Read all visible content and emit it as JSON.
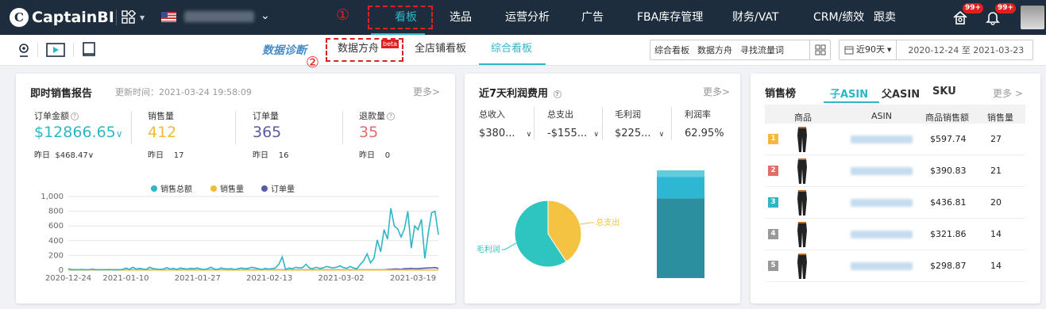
{
  "header": {
    "logo_text": "CaptainBI",
    "nav": [
      "看板",
      "选品",
      "运营分析",
      "广告",
      "FBA库存管理",
      "财务/VAT",
      "CRM/绩效",
      "跟卖"
    ],
    "active_nav": "看板",
    "badges": [
      "99+",
      "99+"
    ],
    "annotation_1": "①",
    "annotation_2": "②"
  },
  "subbar": {
    "brand": "数据诊断",
    "tabs": [
      "数据方舟",
      "全店铺看板",
      "综合看板"
    ],
    "active_tab": "综合看板",
    "beta": "beta",
    "quick_links": [
      "综合看板",
      "数据方舟",
      "寻找流量词"
    ],
    "date_preset": "近90天",
    "date_range": "2020-12-24 至 2021-03-23"
  },
  "sales_report": {
    "title": "即时销售报告",
    "updated": "更新时间：2021-03-24 19:58:09",
    "more": "更多>",
    "metrics": [
      {
        "label": "订单金额",
        "value": "$12866.65",
        "suffix": "∨",
        "prev_label": "昨日",
        "prev": "$468.47",
        "prev_suffix": "∨",
        "color": "#2fb6c6"
      },
      {
        "label": "销售量",
        "value": "412",
        "prev_label": "昨日",
        "prev": "17",
        "color": "#f5b93a"
      },
      {
        "label": "订单量",
        "value": "365",
        "prev_label": "昨日",
        "prev": "16",
        "color": "#5a5aa8"
      },
      {
        "label": "退款量",
        "value": "35",
        "prev_label": "昨日",
        "prev": "0",
        "color": "#e56b6b"
      }
    ],
    "legend": [
      "销售总额",
      "销售量",
      "订单量"
    ]
  },
  "chart_data": {
    "type": "line",
    "x_ticks": [
      "2020-12-24",
      "2021-01-10",
      "2021-01-27",
      "2021-02-13",
      "2021-03-02",
      "2021-03-19"
    ],
    "ylim": [
      0,
      1000
    ],
    "y_ticks": [
      "0",
      "200",
      "400",
      "600",
      "800",
      "1,000"
    ],
    "legend_position": "top",
    "series": [
      {
        "name": "销售总额",
        "color": "#2fb6c6",
        "values": [
          20,
          5,
          8,
          5,
          10,
          5,
          5,
          15,
          8,
          5,
          8,
          5,
          10,
          5,
          8,
          5,
          10,
          30,
          10,
          40,
          15,
          25,
          15,
          10,
          40,
          20,
          15,
          10,
          15,
          35,
          15,
          25,
          10,
          30,
          20,
          15,
          25,
          20,
          30,
          15,
          10,
          20,
          40,
          15,
          10,
          30,
          20,
          15,
          20,
          10,
          20,
          30,
          20,
          25,
          40,
          30,
          20,
          10,
          25,
          15,
          20,
          30,
          80,
          180,
          10,
          30,
          20,
          40,
          30,
          35,
          80,
          30,
          20,
          40,
          25,
          30,
          50,
          40,
          30,
          40,
          60,
          35,
          25,
          50,
          30,
          20,
          80,
          130,
          220,
          100,
          160,
          410,
          250,
          550,
          420,
          840,
          600,
          560,
          450,
          560,
          800,
          300,
          600,
          550,
          690,
          160,
          500,
          780,
          800,
          480
        ]
      },
      {
        "name": "销售量",
        "color": "#f5b93a",
        "values": [
          3,
          3,
          3,
          3,
          3,
          3,
          3,
          3,
          3,
          3,
          3,
          3,
          3,
          3,
          3,
          3,
          3,
          3,
          3,
          3,
          3,
          3,
          3,
          3,
          3,
          3,
          3,
          3,
          3,
          3,
          3,
          3,
          3,
          3,
          3,
          3,
          3,
          3,
          3,
          3,
          3,
          3,
          3,
          3,
          3,
          3,
          3,
          3,
          3,
          3,
          3,
          3,
          3,
          3,
          3,
          3,
          3,
          3,
          3,
          3,
          3,
          3,
          3,
          3,
          3,
          3,
          3,
          3,
          3,
          3,
          3,
          3,
          3,
          3,
          3,
          3,
          3,
          3,
          3,
          3,
          3,
          3,
          3,
          3,
          3,
          3,
          3,
          3,
          3,
          3,
          3,
          3,
          3,
          3,
          3,
          3,
          3,
          3,
          3,
          3,
          3,
          3,
          3,
          3,
          3,
          3,
          3,
          3,
          3,
          3
        ]
      },
      {
        "name": "订单量",
        "color": "#5a5aa8",
        "values": [
          10,
          8,
          6,
          5,
          5,
          5,
          5,
          5,
          5,
          5,
          5,
          5,
          5,
          5,
          5,
          5,
          5,
          5,
          5,
          5,
          5,
          5,
          5,
          5,
          5,
          5,
          5,
          5,
          5,
          5,
          5,
          5,
          5,
          5,
          5,
          5,
          5,
          5,
          5,
          5,
          5,
          5,
          5,
          5,
          5,
          5,
          5,
          5,
          5,
          5,
          5,
          5,
          5,
          5,
          5,
          5,
          5,
          5,
          5,
          5,
          5,
          5,
          5,
          5,
          5,
          5,
          5,
          5,
          5,
          5,
          5,
          5,
          5,
          5,
          5,
          5,
          5,
          5,
          5,
          5,
          5,
          5,
          5,
          5,
          5,
          5,
          5,
          5,
          5,
          5,
          5,
          5,
          5,
          5,
          10,
          12,
          15,
          15,
          12,
          20,
          20,
          25,
          22,
          20,
          25,
          28,
          30,
          32,
          35,
          25
        ]
      }
    ]
  },
  "profit": {
    "title": "近7天利润费用",
    "more": "更多>",
    "cols": [
      {
        "label": "总收入",
        "value": "$380...",
        "suffix": "∨"
      },
      {
        "label": "总支出",
        "value": "-$155...",
        "suffix": "∨"
      },
      {
        "label": "毛利润",
        "value": "$225...",
        "suffix": "∨"
      },
      {
        "label": "利润率",
        "value": "62.95%"
      }
    ],
    "pie": {
      "labels": [
        "毛利润",
        "总支出"
      ],
      "values": [
        59.2,
        40.8
      ],
      "colors": [
        "#2ec4c0",
        "#f5c342"
      ]
    },
    "bar_segments": [
      {
        "value": 6
      },
      {
        "value": 20
      },
      {
        "value": 74
      }
    ],
    "bar_colors": [
      "#5fcddc",
      "#2db7d3",
      "#2b8f9f"
    ]
  },
  "ranking": {
    "title": "销售榜",
    "tabs": [
      "子ASIN",
      "父ASIN",
      "SKU"
    ],
    "active_tab": "子ASIN",
    "more": "更多 >",
    "headers": [
      "商品",
      "ASIN",
      "商品销售额",
      "销售量"
    ],
    "rows": [
      {
        "rank": "1",
        "amount": "$597.74",
        "qty": "27",
        "color": "#f5b93a"
      },
      {
        "rank": "2",
        "amount": "$390.83",
        "qty": "21",
        "color": "#e56b6b"
      },
      {
        "rank": "3",
        "amount": "$436.81",
        "qty": "20",
        "color": "#2fb6c6"
      },
      {
        "rank": "4",
        "amount": "$321.86",
        "qty": "14",
        "color": "#999999"
      },
      {
        "rank": "5",
        "amount": "$298.87",
        "qty": "14",
        "color": "#999999"
      }
    ]
  }
}
